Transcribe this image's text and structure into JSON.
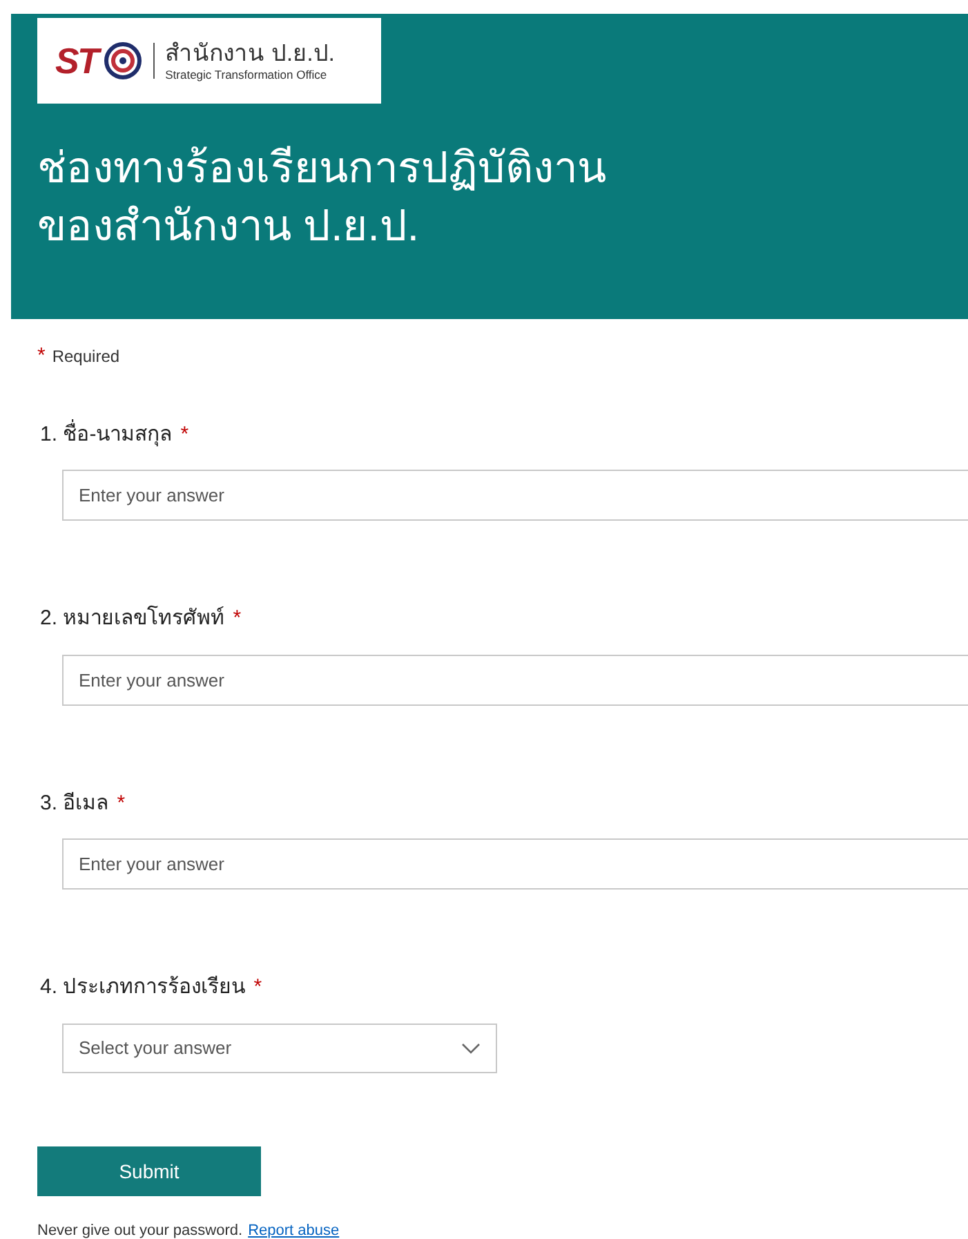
{
  "header": {
    "logo": {
      "mark": "ST",
      "name": "สำนักงาน ป.ย.ป.",
      "subtitle": "Strategic Transformation Office"
    },
    "title_lines": [
      "ช่องทางร้องเรียนการปฏิบัติงาน",
      "ของสำนักงาน ป.ย.ป."
    ]
  },
  "required_note": {
    "mark": "*",
    "text": "Required"
  },
  "questions": [
    {
      "number": "1.",
      "label": "ชื่อ-นามสกุล",
      "required": true,
      "required_mark": "*",
      "kind": "text",
      "placeholder": "Enter your answer"
    },
    {
      "number": "2.",
      "label": "หมายเลขโทรศัพท์",
      "required": true,
      "required_mark": "*",
      "kind": "text",
      "placeholder": "Enter your answer"
    },
    {
      "number": "3.",
      "label": "อีเมล",
      "required": true,
      "required_mark": "*",
      "kind": "text",
      "placeholder": "Enter your answer"
    },
    {
      "number": "4.",
      "label": "ประเภทการร้องเรียน",
      "required": true,
      "required_mark": "*",
      "kind": "select",
      "placeholder": "Select your answer"
    }
  ],
  "submit": "Submit",
  "footer": {
    "text": "Never give out your password.",
    "link": "Report abuse"
  }
}
